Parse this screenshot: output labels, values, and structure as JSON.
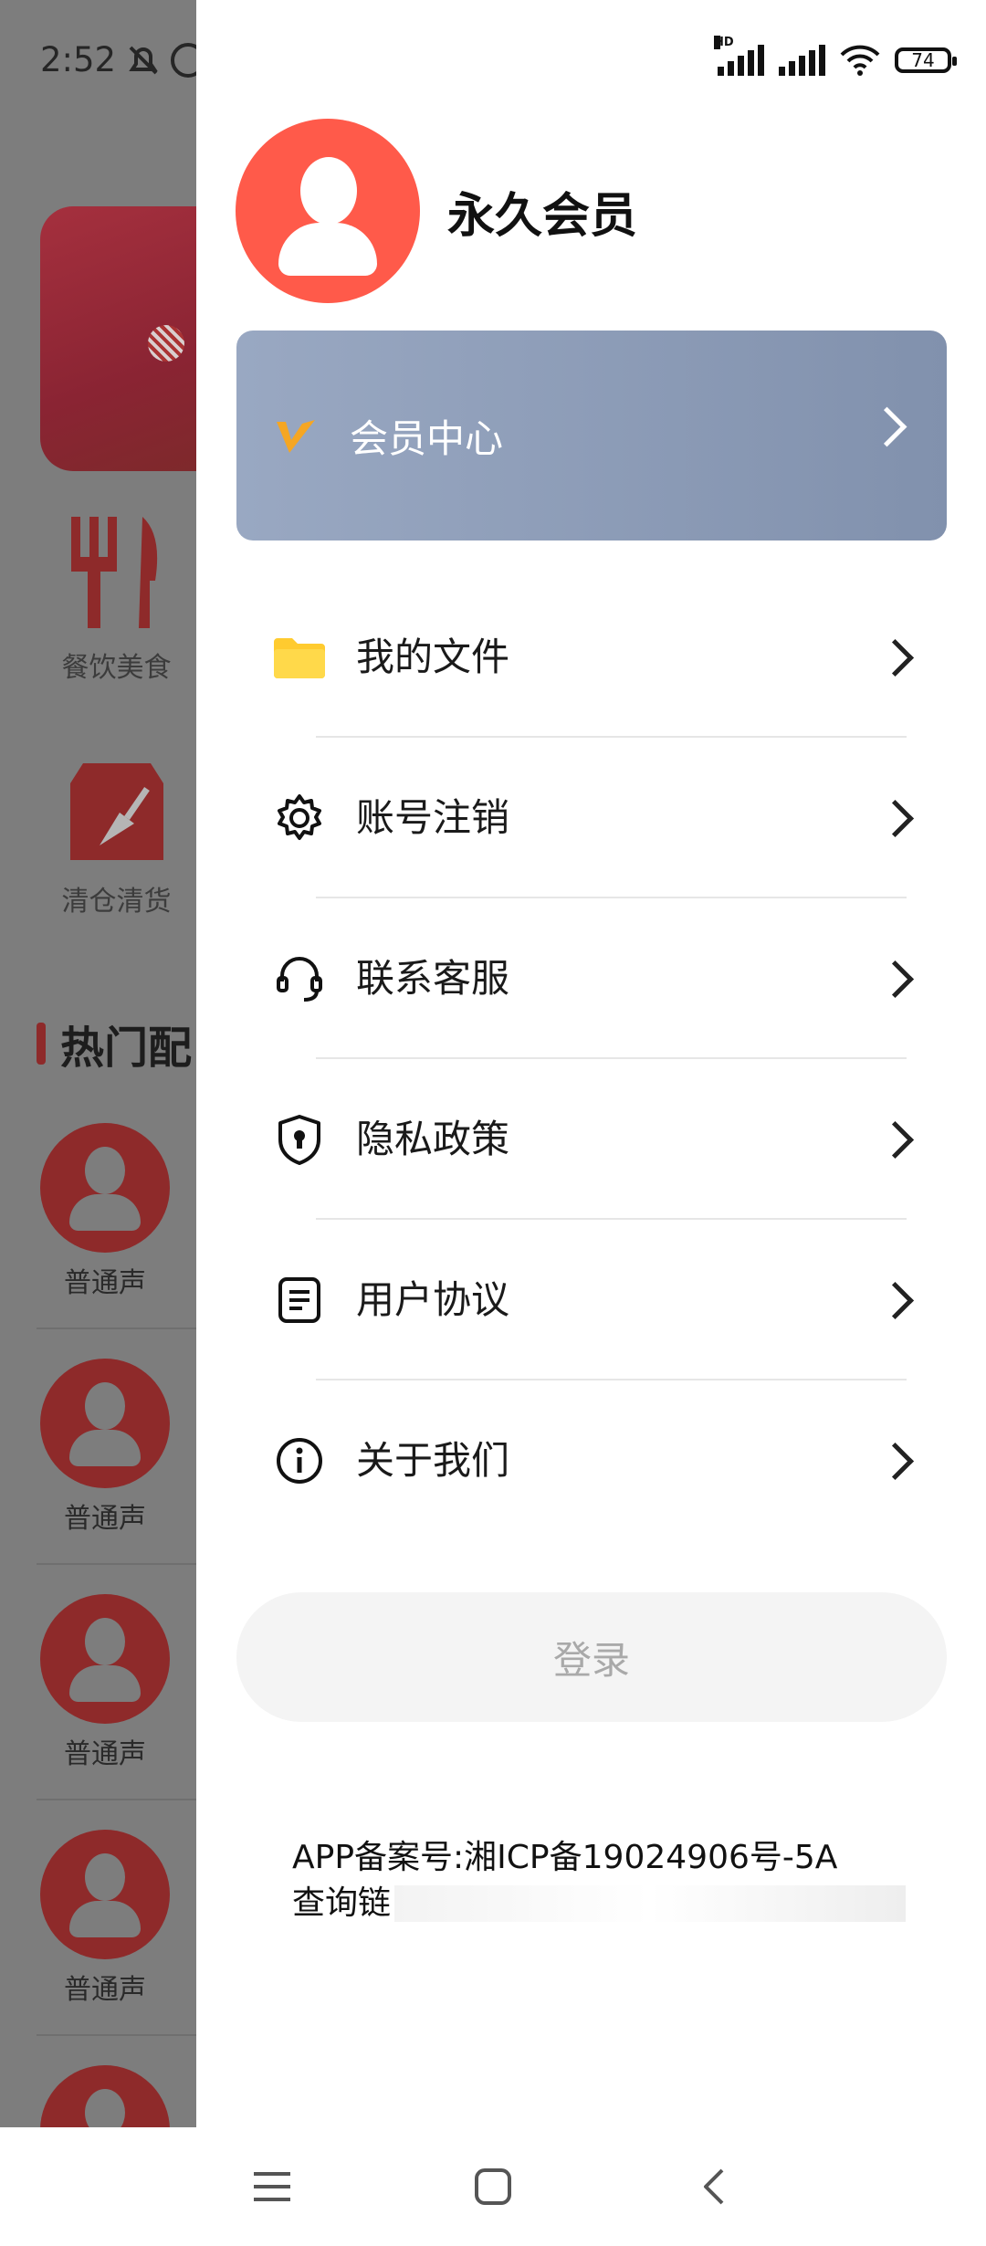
{
  "background_app": {
    "status_time": "2:52",
    "categories": [
      {
        "label": "餐饮美食",
        "icon": "fork-knife-icon"
      },
      {
        "label": "清仓清货",
        "icon": "box-broom-icon"
      }
    ],
    "section_title": "热门配",
    "list_items": [
      "普通声",
      "普通声",
      "普通声",
      "普通声"
    ]
  },
  "status_bar": {
    "network": "HD",
    "battery": "74"
  },
  "drawer": {
    "user_name": "永久会员",
    "vip_card_label": "会员中心",
    "menu": [
      {
        "label": "我的文件",
        "icon": "folder-icon"
      },
      {
        "label": "账号注销",
        "icon": "gear-icon"
      },
      {
        "label": "联系客服",
        "icon": "headset-icon"
      },
      {
        "label": "隐私政策",
        "icon": "shield-icon"
      },
      {
        "label": "用户协议",
        "icon": "document-icon"
      },
      {
        "label": "关于我们",
        "icon": "info-icon"
      }
    ],
    "login_label": "登录",
    "icp_line1": "APP备案号:湘ICP备19024906号-5A",
    "icp_line2": "查询链"
  },
  "colors": {
    "avatar": "#ff5a4a",
    "vip_card_start": "#99a8c2",
    "vip_card_end": "#8191ad",
    "vip_logo": "#f5a623",
    "folder": "#ffcb2f"
  }
}
